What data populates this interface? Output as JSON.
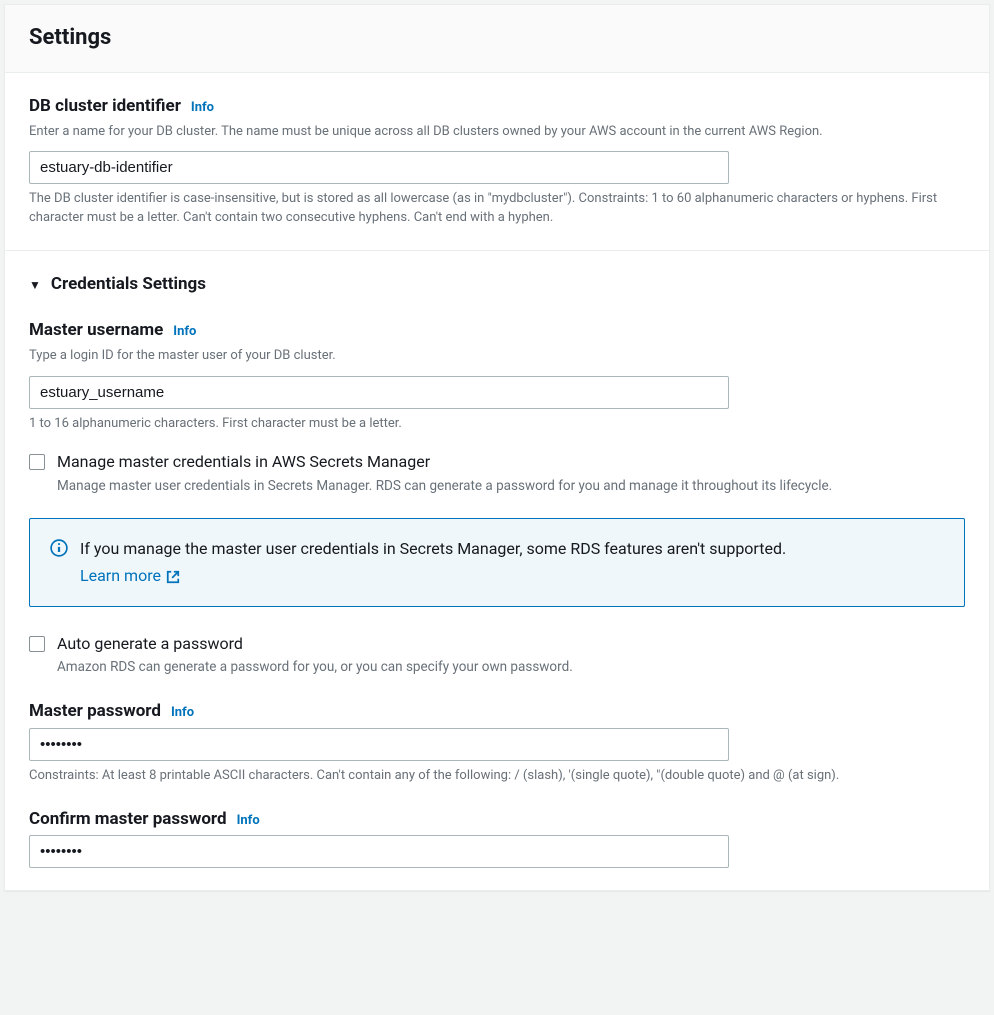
{
  "panel": {
    "title": "Settings"
  },
  "db_identifier": {
    "label": "DB cluster identifier",
    "info_label": "Info",
    "description": "Enter a name for your DB cluster. The name must be unique across all DB clusters owned by your AWS account in the current AWS Region.",
    "value": "estuary-db-identifier",
    "helper": "The DB cluster identifier is case-insensitive, but is stored as all lowercase (as in \"mydbcluster\"). Constraints: 1 to 60 alphanumeric characters or hyphens. First character must be a letter. Can't contain two consecutive hyphens. Can't end with a hyphen."
  },
  "credentials_section": {
    "title": "Credentials Settings"
  },
  "master_username": {
    "label": "Master username",
    "info_label": "Info",
    "description": "Type a login ID for the master user of your DB cluster.",
    "value": "estuary_username",
    "helper": "1 to 16 alphanumeric characters. First character must be a letter."
  },
  "secrets_manager_checkbox": {
    "label": "Manage master credentials in AWS Secrets Manager",
    "description": "Manage master user credentials in Secrets Manager. RDS can generate a password for you and manage it throughout its lifecycle."
  },
  "secrets_alert": {
    "text": "If you manage the master user credentials in Secrets Manager, some RDS features aren't supported.",
    "learn_more": "Learn more"
  },
  "auto_generate_checkbox": {
    "label": "Auto generate a password",
    "description": "Amazon RDS can generate a password for you, or you can specify your own password."
  },
  "master_password": {
    "label": "Master password",
    "info_label": "Info",
    "value": "••••••••",
    "helper": "Constraints: At least 8 printable ASCII characters. Can't contain any of the following: / (slash), '(single quote), \"(double quote) and @ (at sign)."
  },
  "confirm_password": {
    "label": "Confirm master password",
    "info_label": "Info",
    "value": "••••••••"
  }
}
